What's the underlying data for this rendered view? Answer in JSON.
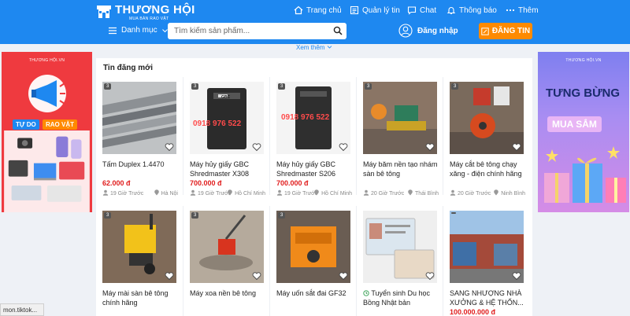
{
  "header": {
    "logo_title": "THƯƠNG HỘI",
    "logo_subtitle": "MUA BÁN RAO VẶT",
    "nav": {
      "home": "Trang chủ",
      "manage": "Quản lý tin",
      "chat": "Chat",
      "notifications": "Thông báo",
      "more": "Thêm"
    },
    "category_label": "Danh mục",
    "search_placeholder": "Tìm kiếm sản phẩm...",
    "login_label": "Đăng nhập",
    "post_label": "ĐĂNG TIN",
    "see_more": "Xem thêm"
  },
  "ads": {
    "left": {
      "brand": "THƯƠNG HỘI.VN",
      "free": "TỰ DO",
      "ads_word": "RAO VẶT"
    },
    "right": {
      "brand": "THƯƠNG HỘI.VN",
      "line1": "TƯNG BỪNG",
      "line2": "MUA SẮM"
    }
  },
  "section_title": "Tin đăng mới",
  "listings": [
    {
      "badge": "3",
      "title": "Tấm Duplex 1.4470",
      "price": "62.000 đ",
      "time": "19 Giờ Trước",
      "location": "Hà Nội"
    },
    {
      "badge": "3",
      "title": "Máy hủy giấy GBC Shredmaster X308",
      "price": "700.000 đ",
      "time": "19 Giờ Trước",
      "location": "Hồ Chí Minh",
      "img_text": "0918 976 522",
      "img_brand": "GBC"
    },
    {
      "badge": "3",
      "title": "Máy hủy giấy GBC Shredmaster S206",
      "price": "700.000 đ",
      "time": "19 Giờ Trước",
      "location": "Hồ Chí Minh",
      "img_text": "0918 976 522"
    },
    {
      "badge": "3",
      "title": "Máy băm nền tạo nhám sàn bê tông",
      "price": "",
      "time": "20 Giờ Trước",
      "location": "Thái Bình"
    },
    {
      "badge": "3",
      "title": "Máy cắt bê tông chạy xăng - điện chính hãng",
      "price": "",
      "time": "20 Giờ Trước",
      "location": "Ninh Bình"
    },
    {
      "badge": "3",
      "title": "Máy mài sàn bê tông chính hãng",
      "price": ""
    },
    {
      "badge": "3",
      "title": "Máy xoa nền bê tông",
      "price": ""
    },
    {
      "badge": "3",
      "title": "Máy uốn sắt đai GF32",
      "price": ""
    },
    {
      "badge": "",
      "title": "Tuyển sinh Du học Bồng Nhật bản",
      "price": ""
    },
    {
      "badge": "",
      "title": "SANG NHƯỢNG NHÀ XƯỞNG & HỆ THỐN...",
      "price": "100.000.000 đ"
    }
  ],
  "status_bar": "mon.tiktok...",
  "colors": {
    "primary": "#1e88f0",
    "accent": "#ff8a00",
    "price": "#e01c1c"
  }
}
